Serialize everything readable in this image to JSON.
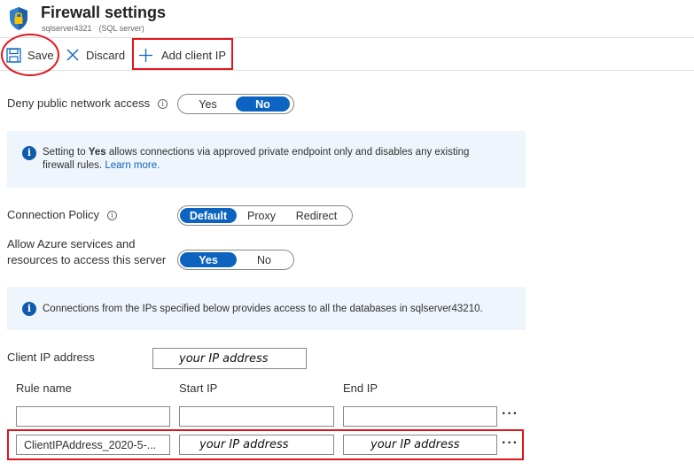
{
  "header": {
    "title": "Firewall settings",
    "server_name": "sqlserver4321",
    "server_type": "(SQL server)",
    "icon": "shield-lock-icon"
  },
  "toolbar": {
    "save_label": "Save",
    "discard_label": "Discard",
    "add_client_ip_label": "Add client IP"
  },
  "deny_public": {
    "label": "Deny public network access",
    "options": [
      "Yes",
      "No"
    ],
    "selected": "No"
  },
  "deny_info": {
    "pre": "Setting to ",
    "bold": "Yes",
    "post": " allows connections via approved private endpoint only and disables any existing firewall rules. ",
    "link": "Learn more."
  },
  "connection_policy": {
    "label": "Connection Policy",
    "options": [
      "Default",
      "Proxy",
      "Redirect"
    ],
    "selected": "Default"
  },
  "allow_azure": {
    "label_line1": "Allow Azure services and",
    "label_line2": "resources to access this server",
    "options": [
      "Yes",
      "No"
    ],
    "selected": "Yes"
  },
  "ip_info": {
    "text": "Connections from the IPs specified below provides access to all the databases in sqlserver43210."
  },
  "client_ip": {
    "label": "Client IP address",
    "value": "your IP address"
  },
  "rules_table": {
    "columns": [
      "Rule name",
      "Start IP",
      "End IP"
    ],
    "rows": [
      {
        "rule_name": "",
        "start_ip": "",
        "end_ip": "",
        "more": "···"
      },
      {
        "rule_name": "ClientIPAddress_2020-5-...",
        "start_ip": "your IP address",
        "end_ip": "your IP address",
        "more": "···"
      }
    ]
  },
  "colors": {
    "accent": "#0c64c0",
    "highlight": "#e0161b",
    "info_bg": "#eef5fc"
  }
}
